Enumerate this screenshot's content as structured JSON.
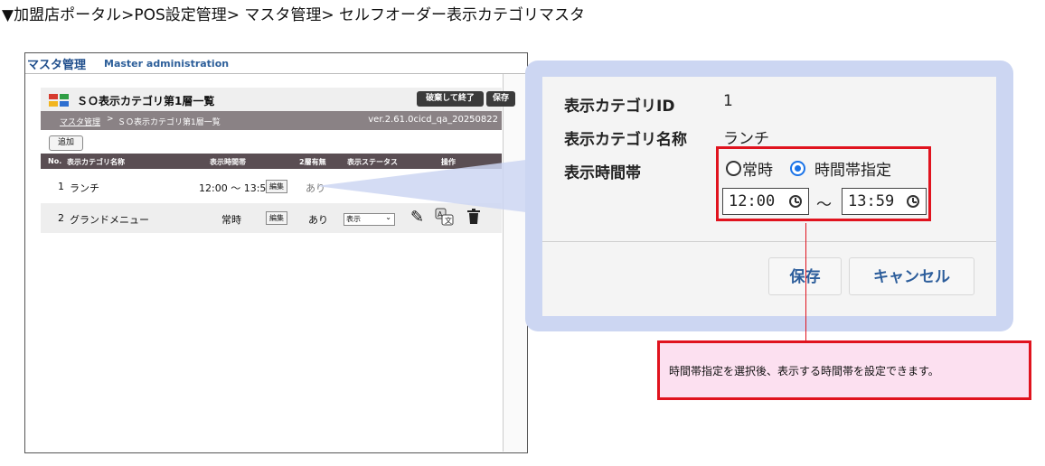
{
  "page_breadcrumb": "▼加盟店ポータル>POS設定管理> マスタ管理> セルフオーダー表示カテゴリマスタ",
  "app": {
    "title": "マスタ管理",
    "subtitle": "Master administration",
    "panel_title": "ＳＯ表示カテゴリ第1層一覧",
    "discard_button": "破棄して終了",
    "save_button": "保存",
    "crumb_link": "マスタ管理",
    "crumb_sep": ">",
    "crumb_current": "ＳＯ表示カテゴリ第1層一覧",
    "version": "ver.2.61.0cicd_qa_20250822",
    "add_button": "追加",
    "columns": [
      "No.",
      "表示カテゴリ名称",
      "表示時間帯",
      "2層有無",
      "表示ステータス",
      "操作"
    ],
    "rows": [
      {
        "no": "1",
        "name": "ランチ",
        "time": "12:00 ～ 13:59",
        "edit": "編集",
        "has_layer2": "あり"
      },
      {
        "no": "2",
        "name": "グランドメニュー",
        "time": "常時",
        "edit": "編集",
        "has_layer2": "あり",
        "status": "表示"
      }
    ],
    "logo_colors": [
      "#d63b2f",
      "#2f9e44",
      "#f2b51f",
      "#2e6fd0"
    ]
  },
  "zoom": {
    "id_label": "表示カテゴリID",
    "id_value": "1",
    "name_label": "表示カテゴリ名称",
    "name_value": "ランチ",
    "time_label": "表示時間帯",
    "radio_always": "常時",
    "radio_specified": "時間帯指定",
    "selected": "時間帯指定",
    "start_time": "12:00",
    "tilde": "～",
    "end_time": "13:59",
    "save_button": "保存",
    "cancel_button": "キャンセル"
  },
  "note": "時間帯指定を選択後、表示する時間帯を設定できます。",
  "colors": {
    "highlight_red": "#e0131e",
    "callout_blue": "#ccd6f2",
    "note_pink": "#fce0f0",
    "link_blue": "#2c5d9b"
  }
}
